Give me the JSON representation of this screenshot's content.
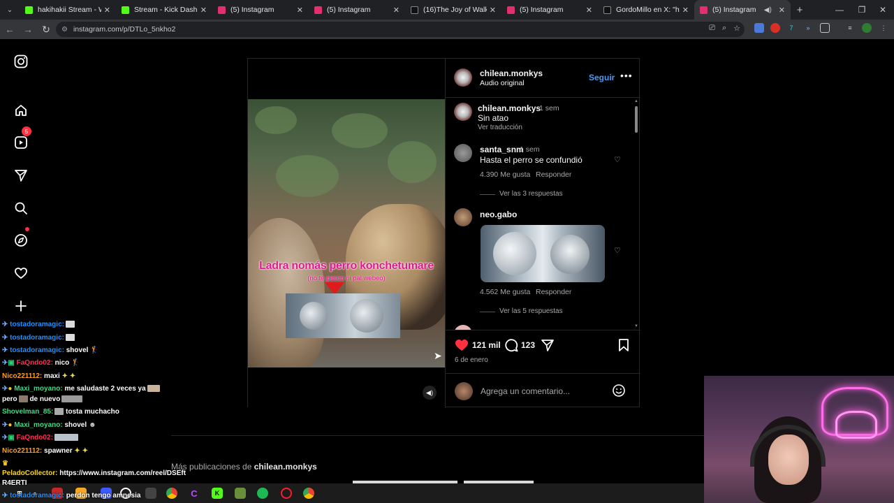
{
  "tabs": [
    {
      "label": "hakihakii Stream - Watch",
      "color": "#53fc18"
    },
    {
      "label": "Stream - Kick Dashboard",
      "color": "#53fc18"
    },
    {
      "label": "(5) Instagram",
      "color": "#e1306c"
    },
    {
      "label": "(5) Instagram",
      "color": "#e1306c"
    },
    {
      "label": "(16)The Joy of Walking w",
      "color": "#000000"
    },
    {
      "label": "(5) Instagram",
      "color": "#e1306c"
    },
    {
      "label": "GordoMillo en X: \"https:/",
      "color": "#000000"
    },
    {
      "label": "(5) Instagram",
      "color": "#e1306c"
    }
  ],
  "url": "instagram.com/p/DTLo_5nkho2",
  "sidebar": {
    "icons": [
      "instagram-logo-icon",
      "home-icon",
      "reels-icon",
      "messages-icon",
      "search-icon",
      "explore-icon",
      "notifications-icon",
      "create-icon"
    ],
    "messages_badge": "5"
  },
  "video": {
    "caption_main": "Ladra nomás perro konchetumare",
    "caption_sub": "(no te pesco ni pal webeo)"
  },
  "post": {
    "author": "chilean.monkys",
    "audio": "Audio original",
    "follow_label": "Seguir",
    "caption_time": "1 sem",
    "caption_text": "Sin atao",
    "translate_label": "Ver traducción",
    "likes": "121 mil",
    "comments_count": "123",
    "date": "6 de enero",
    "add_comment_placeholder": "Agrega un comentario..."
  },
  "comments": [
    {
      "user": "santa_snm",
      "time": "1 sem",
      "text": "Hasta el perro se confundió",
      "likes": "4.390 Me gusta",
      "reply": "Responder",
      "view_replies": "Ver las 3 respuestas"
    },
    {
      "user": "neo.gabo",
      "time": "",
      "text": "",
      "likes": "4.562 Me gusta",
      "reply": "Responder",
      "view_replies": "Ver las 5 respuestas"
    }
  ],
  "more_posts": {
    "prefix": "Más publicaciones de",
    "author": "chilean.monkys"
  },
  "chat": [
    {
      "user": "tostadoramagic:",
      "msg": "",
      "color": "#1e90ff"
    },
    {
      "user": "tostadoramagic:",
      "msg": "",
      "color": "#1e90ff"
    },
    {
      "user": "tostadoramagic:",
      "msg": "shovel",
      "color": "#1e90ff"
    },
    {
      "user": "FaQndo02:",
      "msg": "nico",
      "color": "#ff2d55"
    },
    {
      "user": "Nico221112:",
      "msg": "maxi",
      "color": "#ff9f1c"
    },
    {
      "user": "Maxi_moyano:",
      "msg": "me saludaste 2 veces ya",
      "color": "#3ddc84"
    },
    {
      "user": "",
      "msg": "pero",
      "msg2": "de nuevo",
      "color": "#ffffff"
    },
    {
      "user": "Shovelman_85:",
      "msg": "tosta muchacho",
      "color": "#3ddc84"
    },
    {
      "user": "Maxi_moyano:",
      "msg": "shovel",
      "color": "#3ddc84"
    },
    {
      "user": "FaQndo02:",
      "msg": "",
      "color": "#ff2d55"
    },
    {
      "user": "Nico221112:",
      "msg": "spawner",
      "color": "#ff9f1c"
    },
    {
      "user": "PeladoCollector:",
      "msg": "https://www.instagram.com/reel/DSEft",
      "color": "#ffd60a"
    },
    {
      "user": "",
      "msg": "R4ERTI",
      "color": "#ffffff"
    },
    {
      "user": "tostadoramagic:",
      "msg": "perdon tengo amnesia",
      "color": "#1e90ff"
    }
  ]
}
